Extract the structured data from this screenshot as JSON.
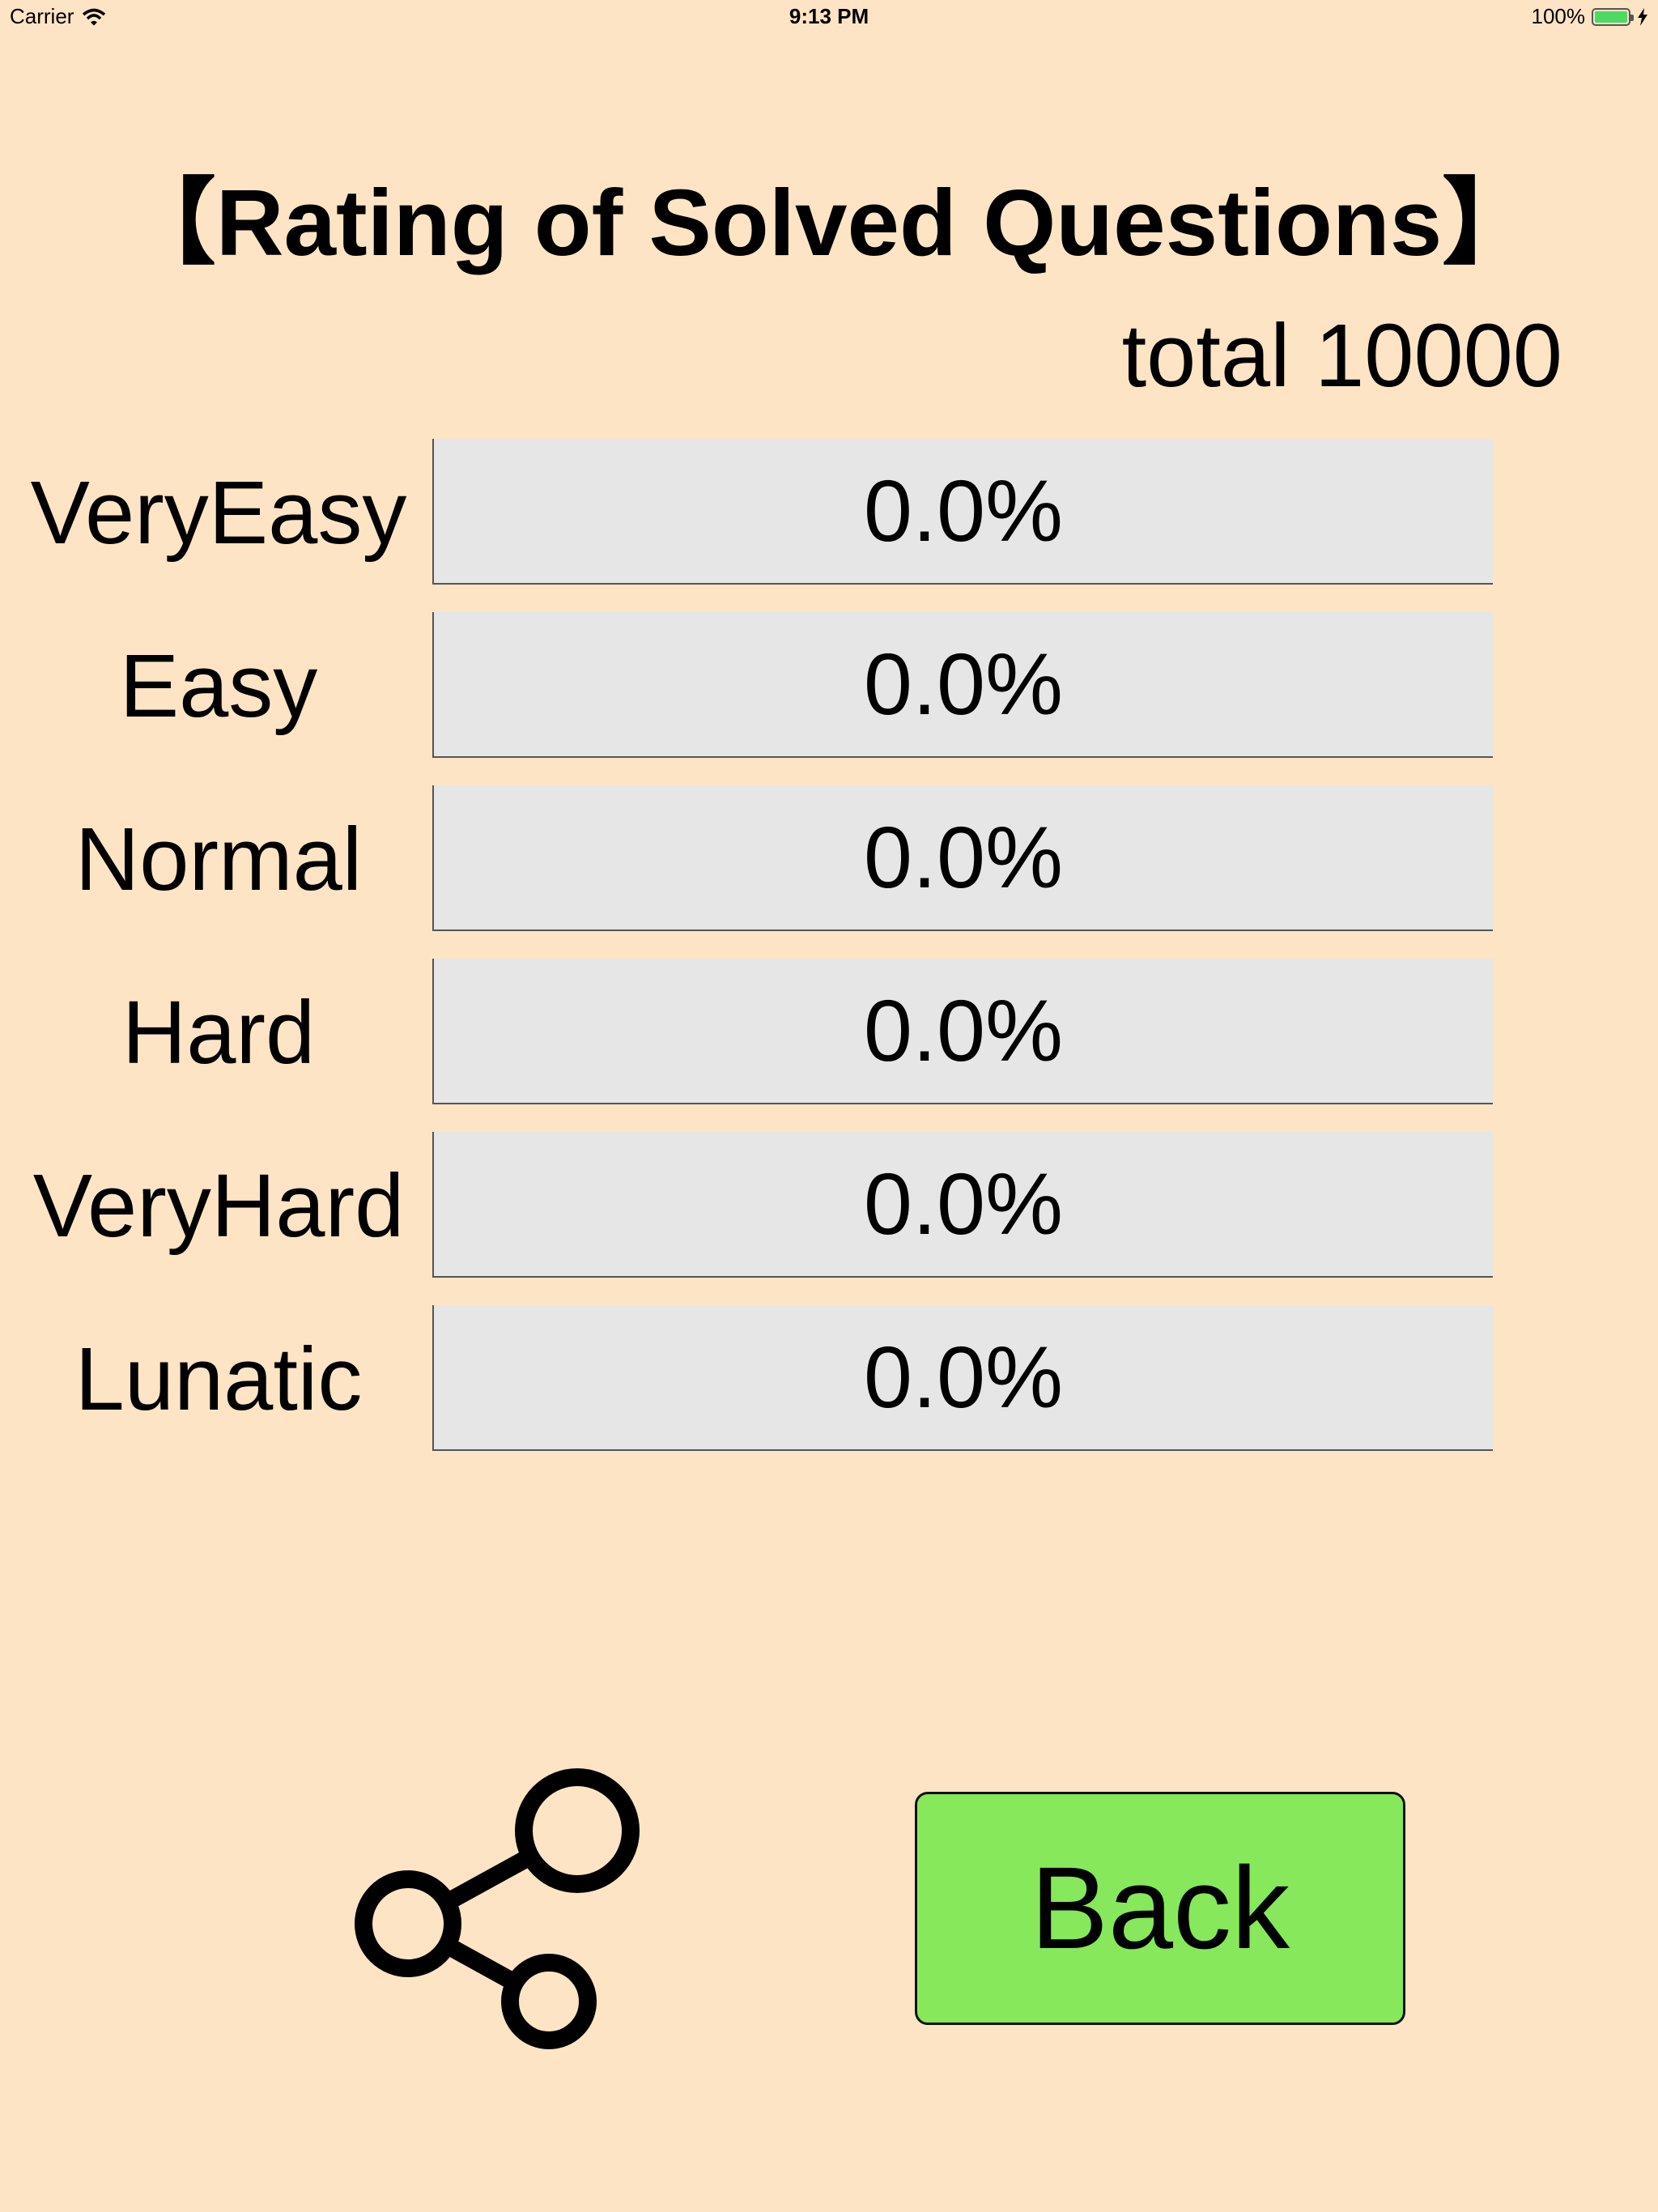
{
  "status_bar": {
    "carrier": "Carrier",
    "time": "9:13 PM",
    "battery": "100%"
  },
  "title": "【Rating of Solved Questions】",
  "total": "total 10000",
  "ratings": [
    {
      "label": "VeryEasy",
      "value": "0.0%"
    },
    {
      "label": "Easy",
      "value": "0.0%"
    },
    {
      "label": "Normal",
      "value": "0.0%"
    },
    {
      "label": "Hard",
      "value": "0.0%"
    },
    {
      "label": "VeryHard",
      "value": "0.0%"
    },
    {
      "label": "Lunatic",
      "value": "0.0%"
    }
  ],
  "share": {
    "icon": "share-icon"
  },
  "back_label": "Back",
  "colors": {
    "background": "#fde4c5",
    "bar": "#e6e6e6",
    "back_button": "#86e85a",
    "battery": "#4cd964"
  }
}
